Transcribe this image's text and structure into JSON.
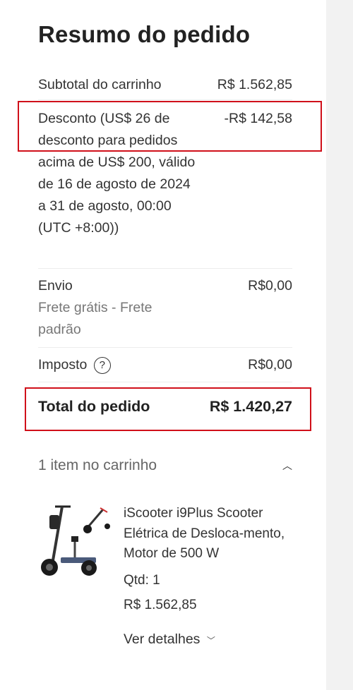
{
  "summary": {
    "title": "Resumo do pedido",
    "subtotal_label": "Subtotal do carrinho",
    "subtotal_value": "R$ 1.562,85",
    "discount_label": "Desconto (US$ 26 de desconto para pedidos acima de US$ 200, válido de 16 de agosto de 2024 a 31 de agosto, 00:00 (UTC +8:00))",
    "discount_value": "-R$ 142,58",
    "shipping_label": "Envio",
    "shipping_note": "Frete grátis - Frete padrão",
    "shipping_value": "R$0,00",
    "tax_label": "Imposto",
    "tax_help_icon": "?",
    "tax_value": "R$0,00",
    "total_label": "Total do pedido",
    "total_value": "R$ 1.420,27"
  },
  "cart": {
    "header": "1 item no carrinho",
    "collapse_icon": "chevron-up-icon",
    "product": {
      "name": "iScooter i9Plus Scooter Elétrica de Desloca-mento, Motor de 500 W",
      "qty": "Qtd: 1",
      "price": "R$ 1.562,85",
      "details_link": "Ver detalhes"
    }
  },
  "colors": {
    "highlight_box": "#d0101a",
    "background": "#f2f2f2"
  }
}
